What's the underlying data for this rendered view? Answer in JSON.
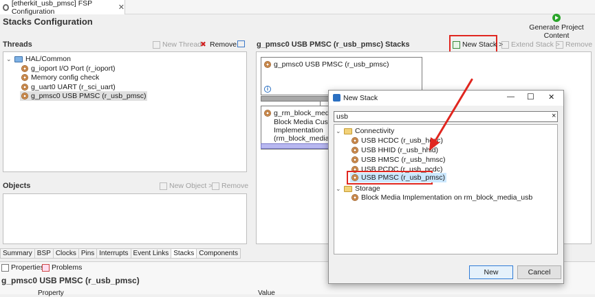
{
  "editor_tab": {
    "label": "[etherkit_usb_pmsc] FSP Configuration"
  },
  "page": {
    "title": "Stacks Configuration",
    "generate_label": "Generate Project Content"
  },
  "threads": {
    "title": "Threads",
    "new_thread_label": "New Thread",
    "remove_label": "Remove",
    "group": "HAL/Common",
    "items": [
      "g_ioport I/O Port (r_ioport)",
      "Memory config check",
      "g_uart0 UART (r_sci_uart)",
      "g_pmsc0 USB PMSC (r_usb_pmsc)"
    ]
  },
  "objects": {
    "title": "Objects",
    "new_object_label": "New Object >",
    "remove_label": "Remove"
  },
  "stacks": {
    "title": "g_pmsc0 USB PMSC (r_usb_pmsc) Stacks",
    "new_stack_label": "New Stack >",
    "extend_stack_label": "Extend Stack >",
    "remove_label": "Remove",
    "card1": "g_pmsc0 USB PMSC (r_usb_pmsc)",
    "card2_lines": [
      "g_rm_block_media0",
      "Block Media Custom",
      "Implementation",
      "(rm_block_media_us"
    ]
  },
  "bottom_tabs": [
    "Summary",
    "BSP",
    "Clocks",
    "Pins",
    "Interrupts",
    "Event Links",
    "Stacks",
    "Components"
  ],
  "properties": {
    "tab_properties": "Properties",
    "tab_problems": "Problems",
    "heading": "g_pmsc0 USB PMSC (r_usb_pmsc)",
    "col_property": "Property",
    "col_value": "Value"
  },
  "dialog": {
    "title": "New Stack",
    "search_value": "usb",
    "clear_label": "×",
    "categories": [
      {
        "name": "Connectivity",
        "items": [
          "USB HCDC (r_usb_hcdc)",
          "USB HHID (r_usb_hhid)",
          "USB HMSC (r_usb_hmsc)",
          "USB PCDC (r_usb_pcdc)",
          "USB PMSC (r_usb_pmsc)"
        ]
      },
      {
        "name": "Storage",
        "items": [
          "Block Media Implementation on rm_block_media_usb"
        ]
      }
    ],
    "new_label": "New",
    "cancel_label": "Cancel",
    "minimize": "—",
    "maximize": "☐",
    "close": "✕"
  },
  "colors": {
    "annotation_red": "#e0261f",
    "selection_blue": "#cce8ff"
  }
}
